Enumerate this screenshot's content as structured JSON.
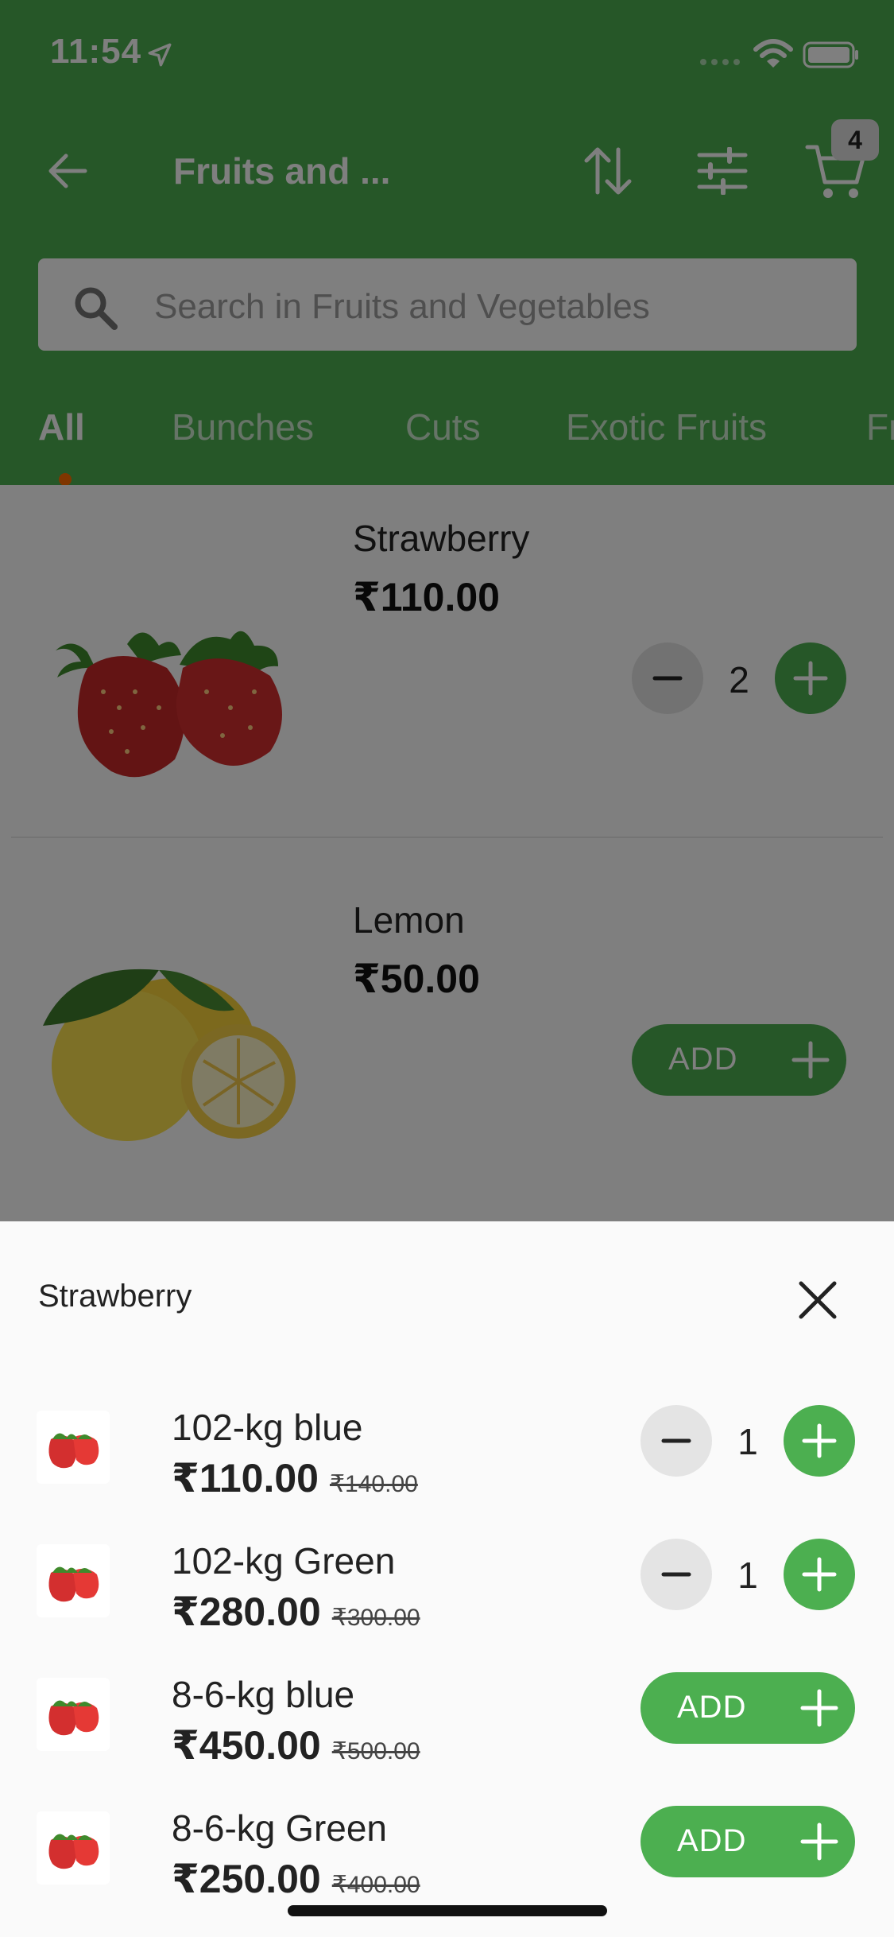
{
  "status_bar": {
    "time": "11:54"
  },
  "header": {
    "title": "Fruits and ...",
    "search_placeholder": "Search in Fruits and Vegetables",
    "cart_count": "4",
    "accent_color": "#4caf50"
  },
  "tabs": [
    {
      "label": "All",
      "active": true
    },
    {
      "label": "Bunches",
      "active": false
    },
    {
      "label": "Cuts",
      "active": false
    },
    {
      "label": "Exotic Fruits",
      "active": false
    },
    {
      "label": "Fr",
      "active": false
    }
  ],
  "products": [
    {
      "name": "Strawberry",
      "price": "₹110.00",
      "quantity": "2",
      "image": "strawberry",
      "in_cart": true
    },
    {
      "name": "Lemon",
      "price": "₹50.00",
      "add_label": "ADD",
      "image": "lemon",
      "in_cart": false
    }
  ],
  "sheet": {
    "title": "Strawberry",
    "variants": [
      {
        "name": "102-kg blue",
        "price": "₹110.00",
        "mrp": "₹140.00",
        "quantity": "1",
        "in_cart": true
      },
      {
        "name": "102-kg Green",
        "price": "₹280.00",
        "mrp": "₹300.00",
        "quantity": "1",
        "in_cart": true
      },
      {
        "name": "8-6-kg blue",
        "price": "₹450.00",
        "mrp": "₹500.00",
        "add_label": "ADD",
        "in_cart": false
      },
      {
        "name": "8-6-kg Green",
        "price": "₹250.00",
        "mrp": "₹400.00",
        "add_label": "ADD",
        "in_cart": false
      }
    ]
  }
}
